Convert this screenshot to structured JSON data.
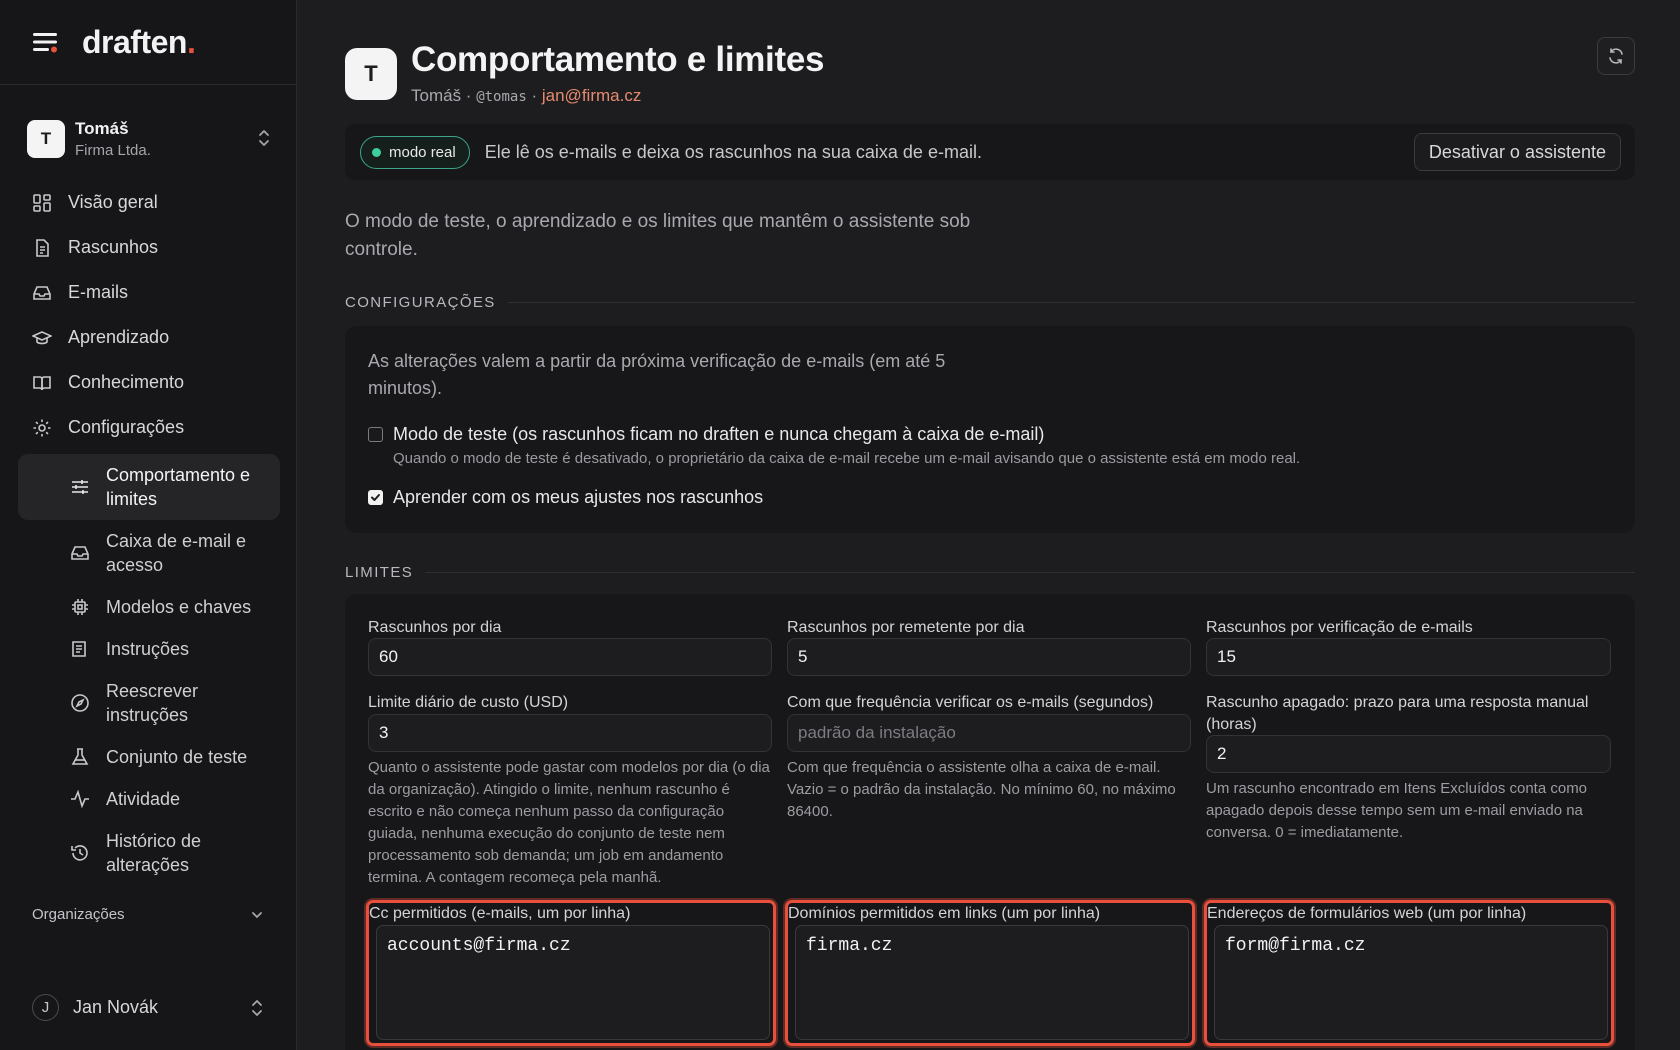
{
  "brand": {
    "name": "draften",
    "dot": "."
  },
  "org_switcher": {
    "initial": "T",
    "name": "Tomáš",
    "company": "Firma Ltda."
  },
  "nav": {
    "items": [
      {
        "label": "Visão geral",
        "icon": "grid-icon"
      },
      {
        "label": "Rascunhos",
        "icon": "file-icon"
      },
      {
        "label": "E-mails",
        "icon": "inbox-icon"
      },
      {
        "label": "Aprendizado",
        "icon": "graduation-cap-icon"
      },
      {
        "label": "Conhecimento",
        "icon": "book-icon"
      },
      {
        "label": "Configurações",
        "icon": "gear-icon"
      }
    ],
    "sub_items": [
      {
        "label": "Comportamento e limites",
        "icon": "sliders-icon",
        "active": true
      },
      {
        "label": "Caixa de e-mail e acesso",
        "icon": "inbox-icon"
      },
      {
        "label": "Modelos e chaves",
        "icon": "chip-icon"
      },
      {
        "label": "Instruções",
        "icon": "list-icon"
      },
      {
        "label": "Reescrever instruções",
        "icon": "compass-icon"
      },
      {
        "label": "Conjunto de teste",
        "icon": "flask-icon"
      },
      {
        "label": "Atividade",
        "icon": "activity-icon"
      },
      {
        "label": "Histórico de alterações",
        "icon": "history-icon"
      }
    ],
    "organizations_label": "Organizações"
  },
  "user": {
    "initial": "J",
    "name": "Jan Novák"
  },
  "header": {
    "initial": "T",
    "title": "Comportamento e limites",
    "name": "Tomáš",
    "sep1": " · ",
    "handle": "@tomas",
    "sep2": " · ",
    "email": "jan@firma.cz"
  },
  "status": {
    "badge": "modo real",
    "text": "Ele lê os e-mails e deixa os rascunhos na sua caixa de e-mail.",
    "button": "Desativar o assistente",
    "colors": {
      "badge_dot": "#3ecf9a",
      "badge_border": "#3ca58a"
    }
  },
  "intro": "O modo de teste, o aprendizado e os limites que mantêm o assistente sob controle.",
  "settings": {
    "heading": "CONFIGURAÇÕES",
    "note": "As alterações valem a partir da próxima verificação de e-mails (em até 5 minutos).",
    "test_mode": {
      "label": "Modo de teste (os rascunhos ficam no draften e nunca chegam à caixa de e-mail)",
      "hint": "Quando o modo de teste é desativado, o proprietário da caixa de e-mail recebe um e-mail avisando que o assistente está em modo real.",
      "checked": false
    },
    "learn": {
      "label": "Aprender com os meus ajustes nos rascunhos",
      "checked": true
    }
  },
  "limits": {
    "heading": "LIMITES",
    "drafts_per_day": {
      "label": "Rascunhos por dia",
      "value": "60"
    },
    "drafts_per_sender": {
      "label": "Rascunhos por remetente por dia",
      "value": "5"
    },
    "drafts_per_check": {
      "label": "Rascunhos por verificação de e-mails",
      "value": "15"
    },
    "daily_cost": {
      "label": "Limite diário de custo (USD)",
      "value": "3",
      "help": "Quanto o assistente pode gastar com modelos por dia (o dia da organização). Atingido o limite, nenhum rascunho é escrito e não começa nenhum passo da configuração guiada, nenhuma execução do conjunto de teste nem processamento sob demanda; um job em andamento termina. A contagem recomeça pela manhã."
    },
    "check_frequency": {
      "label": "Com que frequência verificar os e-mails (segundos)",
      "value": "",
      "placeholder": "padrão da instalação",
      "help": "Com que frequência o assistente olha a caixa de e-mail. Vazio = o padrão da instalação. No mínimo 60, no máximo 86400."
    },
    "deleted_draft": {
      "label": "Rascunho apagado: prazo para uma resposta manual (horas)",
      "value": "2",
      "help": "Um rascunho encontrado em Itens Excluídos conta como apagado depois desse tempo sem um e-mail enviado na conversa. 0 = imediatamente."
    },
    "allowed_cc": {
      "label": "Cc permitidos (e-mails, um por linha)",
      "value": "accounts@firma.cz"
    },
    "allowed_domains": {
      "label": "Domínios permitidos em links (um por linha)",
      "value": "firma.cz"
    },
    "web_forms": {
      "label": "Endereços de formulários web (um por linha)",
      "value": "form@firma.cz"
    }
  },
  "colors": {
    "accent": "#e5533d",
    "highlight_border": "#e8503d",
    "email_link": "#e58a6f"
  }
}
